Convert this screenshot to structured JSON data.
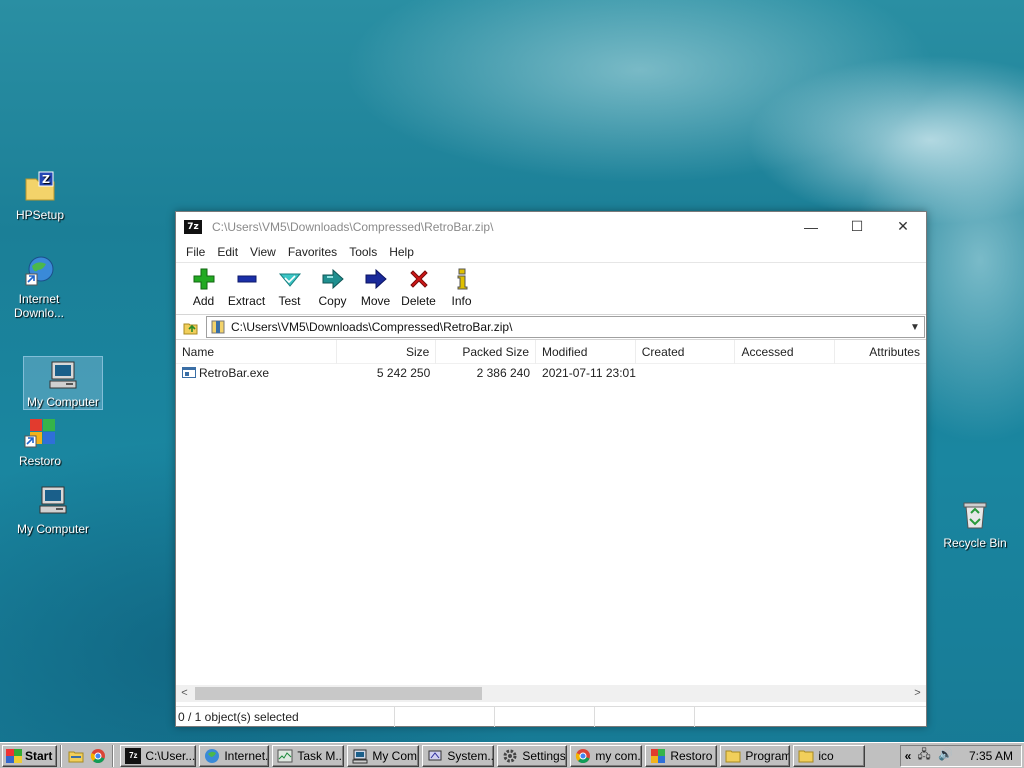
{
  "desktop": {
    "icons": [
      {
        "label": "HPSetup",
        "icon": "zip-folder-icon"
      },
      {
        "label": "Internet Downlo...",
        "icon": "internet-download-icon"
      },
      {
        "label": "My Computer",
        "icon": "computer-icon",
        "selected": true
      },
      {
        "label": "Restoro",
        "icon": "restoro-icon"
      },
      {
        "label": "My Computer",
        "icon": "computer-icon"
      },
      {
        "label": "Recycle Bin",
        "icon": "recycle-bin-icon"
      }
    ]
  },
  "window": {
    "app_icon_text": "7z",
    "title": "C:\\Users\\VM5\\Downloads\\Compressed\\RetroBar.zip\\",
    "controls": {
      "minimize": "—",
      "maximize": "☐",
      "close": "✕"
    },
    "menu": [
      "File",
      "Edit",
      "View",
      "Favorites",
      "Tools",
      "Help"
    ],
    "toolbar": [
      {
        "label": "Add",
        "icon": "plus-icon",
        "color": "#22aa22"
      },
      {
        "label": "Extract",
        "icon": "minus-icon",
        "color": "#1a2fa8"
      },
      {
        "label": "Test",
        "icon": "check-arrow-icon",
        "color": "#21a3a3"
      },
      {
        "label": "Copy",
        "icon": "copy-arrow-icon",
        "color": "#1f8f8f"
      },
      {
        "label": "Move",
        "icon": "move-arrow-icon",
        "color": "#1a2a9a"
      },
      {
        "label": "Delete",
        "icon": "x-icon",
        "color": "#d01818"
      },
      {
        "label": "Info",
        "icon": "info-icon",
        "color": "#e0c000"
      }
    ],
    "address": "C:\\Users\\VM5\\Downloads\\Compressed\\RetroBar.zip\\",
    "columns": [
      "Name",
      "Size",
      "Packed Size",
      "Modified",
      "Created",
      "Accessed",
      "Attributes"
    ],
    "rows": [
      {
        "name": "RetroBar.exe",
        "size": "5 242 250",
        "packed": "2 386 240",
        "modified": "2021-07-11 23:01",
        "created": "",
        "accessed": "",
        "attributes": ""
      }
    ],
    "status": [
      "0 / 1 object(s) selected",
      "",
      "",
      ""
    ]
  },
  "taskbar": {
    "start_label": "Start",
    "buttons": [
      "C:\\User...",
      "Internet...",
      "Task M...",
      "My Com...",
      "System...",
      "Settings",
      "my com...",
      "Restoro",
      "Programs",
      "ico"
    ],
    "tray_chevron": "«",
    "tray_icons": "🖧 🔊",
    "clock": "7:35 AM"
  }
}
